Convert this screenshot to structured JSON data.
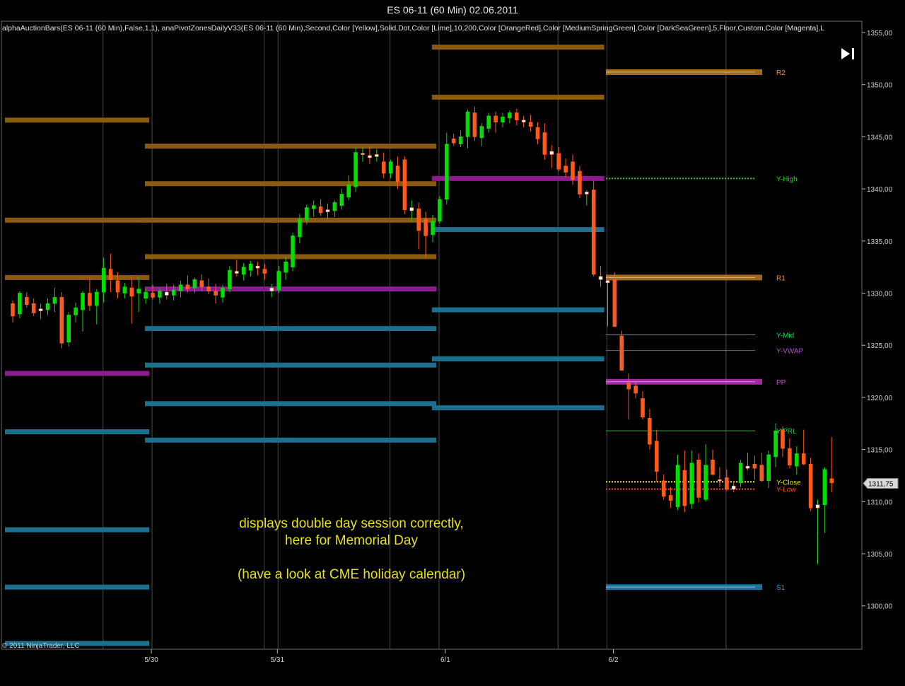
{
  "window": {
    "title": "ES 06-11 (60 Min)  02.06.2011"
  },
  "indicator_line": "alphaAuctionBars(ES  06-11  (60  Min),False,1,1),  anaPivotZonesDailyV33(ES  06-11  (60  Min),Second,Color  [Yellow],Solid,Dot,Color  [Lime],10,200,Color  [OrangeRed],Color  [MediumSpringGreen],Color  [DarkSeaGreen],5,Floor,Custom,Color  [Magenta],L",
  "copyright": "© 2011 NinjaTrader, LLC",
  "price_badge": "1311,75",
  "annotation": {
    "line1": "displays double day session correctly,",
    "line2": "here for Memorial Day",
    "line3": "(have a look at CME holiday calendar)"
  },
  "colors": {
    "bull": "#00e000",
    "bear": "#ff5a1e",
    "doji": "#ffffff",
    "resistance_zone": "#8a5a10",
    "support_zone": "#1d6f8e",
    "pivot_zone": "#8e1a8e",
    "grid": "#4a4a4a",
    "annotation": "#e8e020"
  },
  "chart_data": {
    "type": "candlestick",
    "title": "ES 06-11 (60 Min)  02.06.2011",
    "ylim": [
      1295.5,
      1356.5
    ],
    "y_ticks": [
      "1355,00",
      "1350,00",
      "1345,00",
      "1340,00",
      "1335,00",
      "1330,00",
      "1325,00",
      "1320,00",
      "1315,00",
      "1310,00",
      "1305,00",
      "1300,00"
    ],
    "y_tick_values": [
      1355,
      1350,
      1345,
      1340,
      1335,
      1330,
      1325,
      1320,
      1315,
      1310,
      1305,
      1300
    ],
    "x_date_labels": [
      {
        "label": "5/30",
        "bar": 19
      },
      {
        "label": "5/31",
        "bar": 37
      },
      {
        "label": "6/1",
        "bar": 61
      },
      {
        "label": "6/2",
        "bar": 85
      }
    ],
    "session_separators_bar": [
      12,
      19,
      35,
      37,
      53,
      60,
      77,
      84,
      101
    ],
    "last_price": 1311.75,
    "candles": [
      [
        1329,
        1329.3,
        1327.2,
        1327.8
      ],
      [
        1328,
        1330.2,
        1327.6,
        1330.0
      ],
      [
        1329.6,
        1330.1,
        1328.6,
        1328.9
      ],
      [
        1329,
        1329.5,
        1327.8,
        1328.1
      ],
      [
        1328.5,
        1329.0,
        1327.5,
        1328.3
      ],
      [
        1328.4,
        1329.5,
        1327.9,
        1329.0
      ],
      [
        1329,
        1330.5,
        1328.2,
        1329.6
      ],
      [
        1329.6,
        1330.1,
        1324.7,
        1325.2
      ],
      [
        1325.3,
        1328.2,
        1324.9,
        1327.9
      ],
      [
        1327.9,
        1329.1,
        1327.2,
        1328.6
      ],
      [
        1328.4,
        1330.2,
        1326.3,
        1330.0
      ],
      [
        1330,
        1331.4,
        1328.3,
        1328.8
      ],
      [
        1328.8,
        1330.4,
        1327.0,
        1330.1
      ],
      [
        1330.1,
        1333.4,
        1329.1,
        1332.4
      ],
      [
        1332.3,
        1333.8,
        1330.1,
        1331.3
      ],
      [
        1331.2,
        1332.0,
        1329.5,
        1330.1
      ],
      [
        1330.0,
        1331.0,
        1329.5,
        1330.6
      ],
      [
        1330.5,
        1331.6,
        1327.1,
        1329.7
      ],
      [
        1330.0,
        1331.5,
        1328.2,
        1330.4
      ],
      [
        1329.5,
        1330.5,
        1329.0,
        1330.1
      ],
      [
        1330,
        1330.8,
        1329.4,
        1329.6
      ],
      [
        1329.6,
        1330.5,
        1329.0,
        1330.2
      ],
      [
        1330.1,
        1330.9,
        1329.4,
        1329.8
      ],
      [
        1329.8,
        1330.8,
        1329.3,
        1330.3
      ],
      [
        1330.2,
        1331.2,
        1329.6,
        1330.8
      ],
      [
        1330.8,
        1331.7,
        1330.1,
        1330.4
      ],
      [
        1330.5,
        1331.5,
        1330.0,
        1331.3
      ],
      [
        1331.2,
        1331.8,
        1330.2,
        1330.6
      ],
      [
        1330.6,
        1331.4,
        1329.9,
        1330.2
      ],
      [
        1330.2,
        1330.9,
        1329.0,
        1329.8
      ],
      [
        1329.6,
        1330.8,
        1329.1,
        1330.5
      ],
      [
        1330.4,
        1332.6,
        1330.1,
        1332.2
      ],
      [
        1332.1,
        1333.2,
        1331.6,
        1331.9
      ],
      [
        1331.8,
        1332.9,
        1331.2,
        1332.5
      ],
      [
        1332.2,
        1333.1,
        1331.6,
        1332.8
      ],
      [
        1332.6,
        1333.0,
        1331.7,
        1332.4
      ],
      [
        1332.3,
        1332.8,
        1331.3,
        1331.9
      ],
      [
        1330.2,
        1330.9,
        1329.6,
        1330.5
      ],
      [
        1330.3,
        1332.6,
        1330.0,
        1332.1
      ],
      [
        1332.0,
        1333.5,
        1331.3,
        1333.0
      ],
      [
        1332.5,
        1335.8,
        1332.1,
        1335.5
      ],
      [
        1335.4,
        1337.6,
        1334.8,
        1337.1
      ],
      [
        1337.0,
        1338.5,
        1336.6,
        1338.2
      ],
      [
        1338.1,
        1338.9,
        1337.3,
        1338.4
      ],
      [
        1338.3,
        1339.0,
        1337.4,
        1337.7
      ],
      [
        1337.8,
        1338.6,
        1337.1,
        1338.0
      ],
      [
        1337.9,
        1338.9,
        1337.3,
        1338.7
      ],
      [
        1338.4,
        1340.0,
        1338.0,
        1339.5
      ],
      [
        1339.2,
        1341.3,
        1338.9,
        1340.4
      ],
      [
        1340.2,
        1344.0,
        1339.7,
        1343.5
      ],
      [
        1343.4,
        1344.0,
        1342.6,
        1343.4
      ],
      [
        1343.2,
        1344.1,
        1342.4,
        1343.0
      ],
      [
        1343.1,
        1343.8,
        1342.6,
        1343.3
      ],
      [
        1342.6,
        1343.5,
        1341.0,
        1341.5
      ],
      [
        1341.5,
        1342.8,
        1341.0,
        1342.6
      ],
      [
        1342.2,
        1343.1,
        1340.0,
        1340.7
      ],
      [
        1342.8,
        1343.1,
        1337.6,
        1338.0
      ],
      [
        1337.9,
        1338.9,
        1336.9,
        1338.2
      ],
      [
        1338.1,
        1338.7,
        1334.2,
        1336.0
      ],
      [
        1337.1,
        1337.8,
        1333.4,
        1335.5
      ],
      [
        1335.6,
        1337.5,
        1334.9,
        1336.9
      ],
      [
        1336.9,
        1339.3,
        1336.7,
        1339.0
      ],
      [
        1339.0,
        1345.4,
        1338.5,
        1344.3
      ],
      [
        1344.8,
        1345.3,
        1344.1,
        1344.4
      ],
      [
        1344.3,
        1345.6,
        1344.0,
        1345.0
      ],
      [
        1345.0,
        1347.6,
        1343.9,
        1347.4
      ],
      [
        1347.3,
        1347.9,
        1344.6,
        1345.0
      ],
      [
        1344.9,
        1346.3,
        1344.1,
        1346.0
      ],
      [
        1345.8,
        1347.3,
        1345.4,
        1347.0
      ],
      [
        1347.0,
        1347.4,
        1345.4,
        1346.4
      ],
      [
        1346.4,
        1347.3,
        1345.9,
        1346.9
      ],
      [
        1346.8,
        1347.5,
        1346.3,
        1347.3
      ],
      [
        1347.3,
        1347.7,
        1346.1,
        1346.6
      ],
      [
        1346.6,
        1347.0,
        1345.9,
        1346.4
      ],
      [
        1346.4,
        1347.1,
        1345.5,
        1346.0
      ],
      [
        1345.9,
        1346.4,
        1344.3,
        1344.8
      ],
      [
        1345.4,
        1346.3,
        1342.8,
        1343.3
      ],
      [
        1343.6,
        1344.2,
        1342.0,
        1343.3
      ],
      [
        1343.4,
        1344.0,
        1341.7,
        1341.9
      ],
      [
        1342.2,
        1342.9,
        1341.1,
        1341.6
      ],
      [
        1342.6,
        1343.3,
        1340.4,
        1340.9
      ],
      [
        1341.7,
        1342.2,
        1339.1,
        1339.5
      ],
      [
        1339.5,
        1339.9,
        1338.4,
        1339.7
      ],
      [
        1339.9,
        1340.8,
        1331.6,
        1331.8
      ],
      [
        1331.6,
        1332.6,
        1330.6,
        1331.3
      ],
      [
        1331.2,
        1331.6,
        1326.8,
        1331.0
      ],
      [
        1331.3,
        1332.0,
        1326.8,
        1326.8
      ],
      [
        1325.9,
        1326.4,
        1323.4,
        1322.6
      ],
      [
        1321.4,
        1322.3,
        1317.9,
        1320.8
      ],
      [
        1321.1,
        1321.5,
        1319.9,
        1320.4
      ],
      [
        1319.9,
        1320.6,
        1317.9,
        1318.1
      ],
      [
        1318.0,
        1318.9,
        1315.0,
        1315.5
      ],
      [
        1315.8,
        1316.9,
        1311.9,
        1312.9
      ],
      [
        1312.0,
        1312.6,
        1310.2,
        1310.5
      ],
      [
        1310.6,
        1311.4,
        1309.4,
        1310.1
      ],
      [
        1309.5,
        1314.5,
        1309.2,
        1313.5
      ],
      [
        1313.0,
        1314.9,
        1309.0,
        1309.6
      ],
      [
        1309.8,
        1314.9,
        1309.3,
        1313.7
      ],
      [
        1314.0,
        1314.6,
        1309.9,
        1310.4
      ],
      [
        1310.2,
        1315.5,
        1310.0,
        1313.5
      ],
      [
        1314.0,
        1315.0,
        1312.5,
        1312.6
      ],
      [
        1312.1,
        1313.3,
        1311.4,
        1312.0
      ],
      [
        1312.3,
        1313.1,
        1311.0,
        1311.2
      ],
      [
        1311.5,
        1312.0,
        1310.9,
        1311.2
      ],
      [
        1311.8,
        1314.0,
        1311.4,
        1313.7
      ],
      [
        1313.4,
        1314.7,
        1313.0,
        1313.2
      ],
      [
        1313.6,
        1314.4,
        1312.1,
        1313.2
      ],
      [
        1313.5,
        1314.7,
        1311.9,
        1312.0
      ],
      [
        1312.0,
        1314.9,
        1311.3,
        1314.5
      ],
      [
        1314.3,
        1317.5,
        1313.3,
        1316.8
      ],
      [
        1316.9,
        1317.2,
        1314.3,
        1315.1
      ],
      [
        1315.1,
        1316.1,
        1313.2,
        1313.5
      ],
      [
        1313.4,
        1315.3,
        1312.6,
        1314.6
      ],
      [
        1314.6,
        1316.9,
        1313.5,
        1313.6
      ],
      [
        1313.6,
        1314.2,
        1309.1,
        1309.4
      ],
      [
        1309.4,
        1310.2,
        1304.0,
        1309.7
      ],
      [
        1309.7,
        1313.3,
        1307.0,
        1313.1
      ],
      [
        1312.2,
        1316.2,
        1310.9,
        1311.8
      ]
    ],
    "zones": [
      {
        "kind": "resistance",
        "price": 1346.6,
        "bars": [
          0,
          19
        ]
      },
      {
        "kind": "resistance",
        "price": 1337.0,
        "bars": [
          0,
          19
        ]
      },
      {
        "kind": "resistance",
        "price": 1331.5,
        "bars": [
          0,
          19
        ]
      },
      {
        "kind": "pivot",
        "price": 1322.3,
        "bars": [
          0,
          19
        ]
      },
      {
        "kind": "support",
        "price": 1316.7,
        "bars": [
          0,
          19
        ]
      },
      {
        "kind": "support",
        "price": 1307.3,
        "bars": [
          0,
          19
        ]
      },
      {
        "kind": "support",
        "price": 1301.8,
        "bars": [
          0,
          19
        ]
      },
      {
        "kind": "support",
        "price": 1296.4,
        "bars": [
          0,
          19
        ]
      },
      {
        "kind": "resistance",
        "price": 1344.1,
        "bars": [
          20,
          37
        ]
      },
      {
        "kind": "resistance",
        "price": 1340.5,
        "bars": [
          20,
          37
        ]
      },
      {
        "kind": "resistance",
        "price": 1337.0,
        "bars": [
          20,
          37
        ]
      },
      {
        "kind": "resistance",
        "price": 1333.5,
        "bars": [
          20,
          37
        ]
      },
      {
        "kind": "pivot",
        "price": 1330.4,
        "bars": [
          20,
          37
        ]
      },
      {
        "kind": "support",
        "price": 1326.6,
        "bars": [
          20,
          37
        ]
      },
      {
        "kind": "support",
        "price": 1323.1,
        "bars": [
          20,
          37
        ]
      },
      {
        "kind": "support",
        "price": 1319.4,
        "bars": [
          20,
          37
        ]
      },
      {
        "kind": "support",
        "price": 1315.9,
        "bars": [
          20,
          37
        ]
      },
      {
        "kind": "resistance",
        "price": 1344.1,
        "bars": [
          38,
          60
        ]
      },
      {
        "kind": "resistance",
        "price": 1340.5,
        "bars": [
          38,
          60
        ]
      },
      {
        "kind": "resistance",
        "price": 1337.0,
        "bars": [
          38,
          60
        ]
      },
      {
        "kind": "resistance",
        "price": 1333.5,
        "bars": [
          38,
          60
        ]
      },
      {
        "kind": "pivot",
        "price": 1330.4,
        "bars": [
          38,
          60
        ]
      },
      {
        "kind": "support",
        "price": 1326.6,
        "bars": [
          38,
          60
        ]
      },
      {
        "kind": "support",
        "price": 1323.1,
        "bars": [
          38,
          60
        ]
      },
      {
        "kind": "support",
        "price": 1319.4,
        "bars": [
          38,
          60
        ]
      },
      {
        "kind": "support",
        "price": 1315.9,
        "bars": [
          38,
          60
        ]
      },
      {
        "kind": "resistance",
        "price": 1353.6,
        "bars": [
          61,
          84
        ]
      },
      {
        "kind": "resistance",
        "price": 1348.8,
        "bars": [
          61,
          84
        ]
      },
      {
        "kind": "pivot",
        "price": 1341.0,
        "bars": [
          61,
          84
        ]
      },
      {
        "kind": "support",
        "price": 1336.1,
        "bars": [
          61,
          84
        ]
      },
      {
        "kind": "support",
        "price": 1328.4,
        "bars": [
          61,
          84
        ]
      },
      {
        "kind": "support",
        "price": 1323.7,
        "bars": [
          61,
          84
        ]
      },
      {
        "kind": "support",
        "price": 1319.0,
        "bars": [
          61,
          84
        ]
      }
    ],
    "levels": [
      {
        "label": "R2",
        "price": 1351.2,
        "style": "zone",
        "color": "#c07a1e",
        "label_color": "#f08a3a"
      },
      {
        "label": "Y-High",
        "price": 1341.0,
        "style": "dot",
        "color": "#20d020",
        "label_color": "#20d020"
      },
      {
        "label": "R1",
        "price": 1331.5,
        "style": "zone",
        "color": "#c07a1e",
        "label_color": "#f08a3a"
      },
      {
        "label": "Y-Mid",
        "price": 1326.0,
        "style": "solid",
        "color": "#20c060",
        "label_color": "#20d060"
      },
      {
        "label": "Y-VWAP",
        "price": 1324.5,
        "style": "solid",
        "color": "#a040c0",
        "label_color": "#b050d0"
      },
      {
        "label": "PP",
        "price": 1321.5,
        "style": "zone",
        "color": "#c030c0",
        "label_color": "#e040e0"
      },
      {
        "label": "Y-PRL",
        "price": 1316.8,
        "style": "solid",
        "color": "#20b040",
        "label_color": "#20d040"
      },
      {
        "label": "Y-Close",
        "price": 1311.9,
        "style": "dot",
        "color": "#e8e020",
        "label_color": "#e8e020"
      },
      {
        "label": "Y-Low",
        "price": 1311.2,
        "style": "dot",
        "color": "#ff4020",
        "label_color": "#ff4020"
      },
      {
        "label": "S1",
        "price": 1301.8,
        "style": "zone",
        "color": "#1a8ab8",
        "label_color": "#30a0e0"
      }
    ]
  }
}
